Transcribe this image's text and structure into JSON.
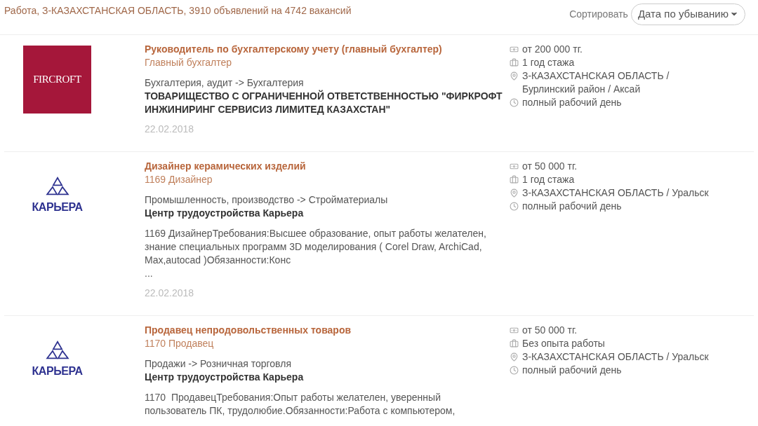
{
  "summary": "Работа, З-КАЗАХСТАНСКАЯ ОБЛАСТЬ, 3910 объявлений на 4742 вакансий",
  "sort": {
    "label": "Сортировать",
    "value": "Дата по убыванию"
  },
  "listings": [
    {
      "logo": {
        "kind": "fircroft",
        "text": "FIRCROFT"
      },
      "title": "Руководитель по бухгалтерскому учету (главный бухгалтер)",
      "position": "Главный бухгалтер",
      "category": "Бухгалтерия, аудит -> Бухгалтерия",
      "company": "ТОВАРИЩЕСТВО С ОГРАНИЧЕННОЙ ОТВЕТСТВЕННОСТЬЮ \"ФИРКРОФТ ИНЖИНИРИНГ СЕРВИСИЗ ЛИМИТЕД КАЗАХСТАН\"",
      "date": "22.02.2018",
      "details": [
        {
          "kind": "salary",
          "text": "от 200 000 тг."
        },
        {
          "kind": "experience",
          "text": "1 год стажа"
        },
        {
          "kind": "location",
          "text": "З-КАЗАХСТАНСКАЯ ОБЛАСТЬ / Бурлинский район / Аксай"
        },
        {
          "kind": "schedule",
          "text": "полный рабочий день"
        }
      ]
    },
    {
      "logo": {
        "kind": "karera",
        "text": "КАРЬЕРА"
      },
      "title": "Дизайнер керамических изделий",
      "position": "1169 Дизайнер",
      "category": "Промышленность, производство -> Стройматериалы",
      "company": "Центр трудоустройства Карьера",
      "description": [
        "1169 ДизайнерТребования:Высшее образование, опыт работы желателен,",
        "знание специальных программ 3D моделирования ( Corel Draw, ArchiCad,",
        "Max,autocad )Обязанности:Конс",
        "..."
      ],
      "date": "22.02.2018",
      "details": [
        {
          "kind": "salary",
          "text": "от 50 000 тг."
        },
        {
          "kind": "experience",
          "text": "1 год стажа"
        },
        {
          "kind": "location",
          "text": "З-КАЗАХСТАНСКАЯ ОБЛАСТЬ / Уральск"
        },
        {
          "kind": "schedule",
          "text": "полный рабочий день"
        }
      ]
    },
    {
      "logo": {
        "kind": "karera",
        "text": "КАРЬЕРА"
      },
      "title": "Продавец непродовольственных товаров",
      "position": "1170 Продавец",
      "category": "Продажи -> Розничная торговля",
      "company": "Центр трудоустройства Карьера",
      "description": [
        "1170  ПродавецТребования:Опыт работы желателен, уверенный",
        "пользователь ПК, трудолюбие.Обязанности:Работа с компьютером,"
      ],
      "details": [
        {
          "kind": "salary",
          "text": "от 50 000 тг."
        },
        {
          "kind": "experience",
          "text": "Без опыта работы"
        },
        {
          "kind": "location",
          "text": "З-КАЗАХСТАНСКАЯ ОБЛАСТЬ / Уральск"
        },
        {
          "kind": "schedule",
          "text": "полный рабочий день"
        }
      ]
    }
  ]
}
